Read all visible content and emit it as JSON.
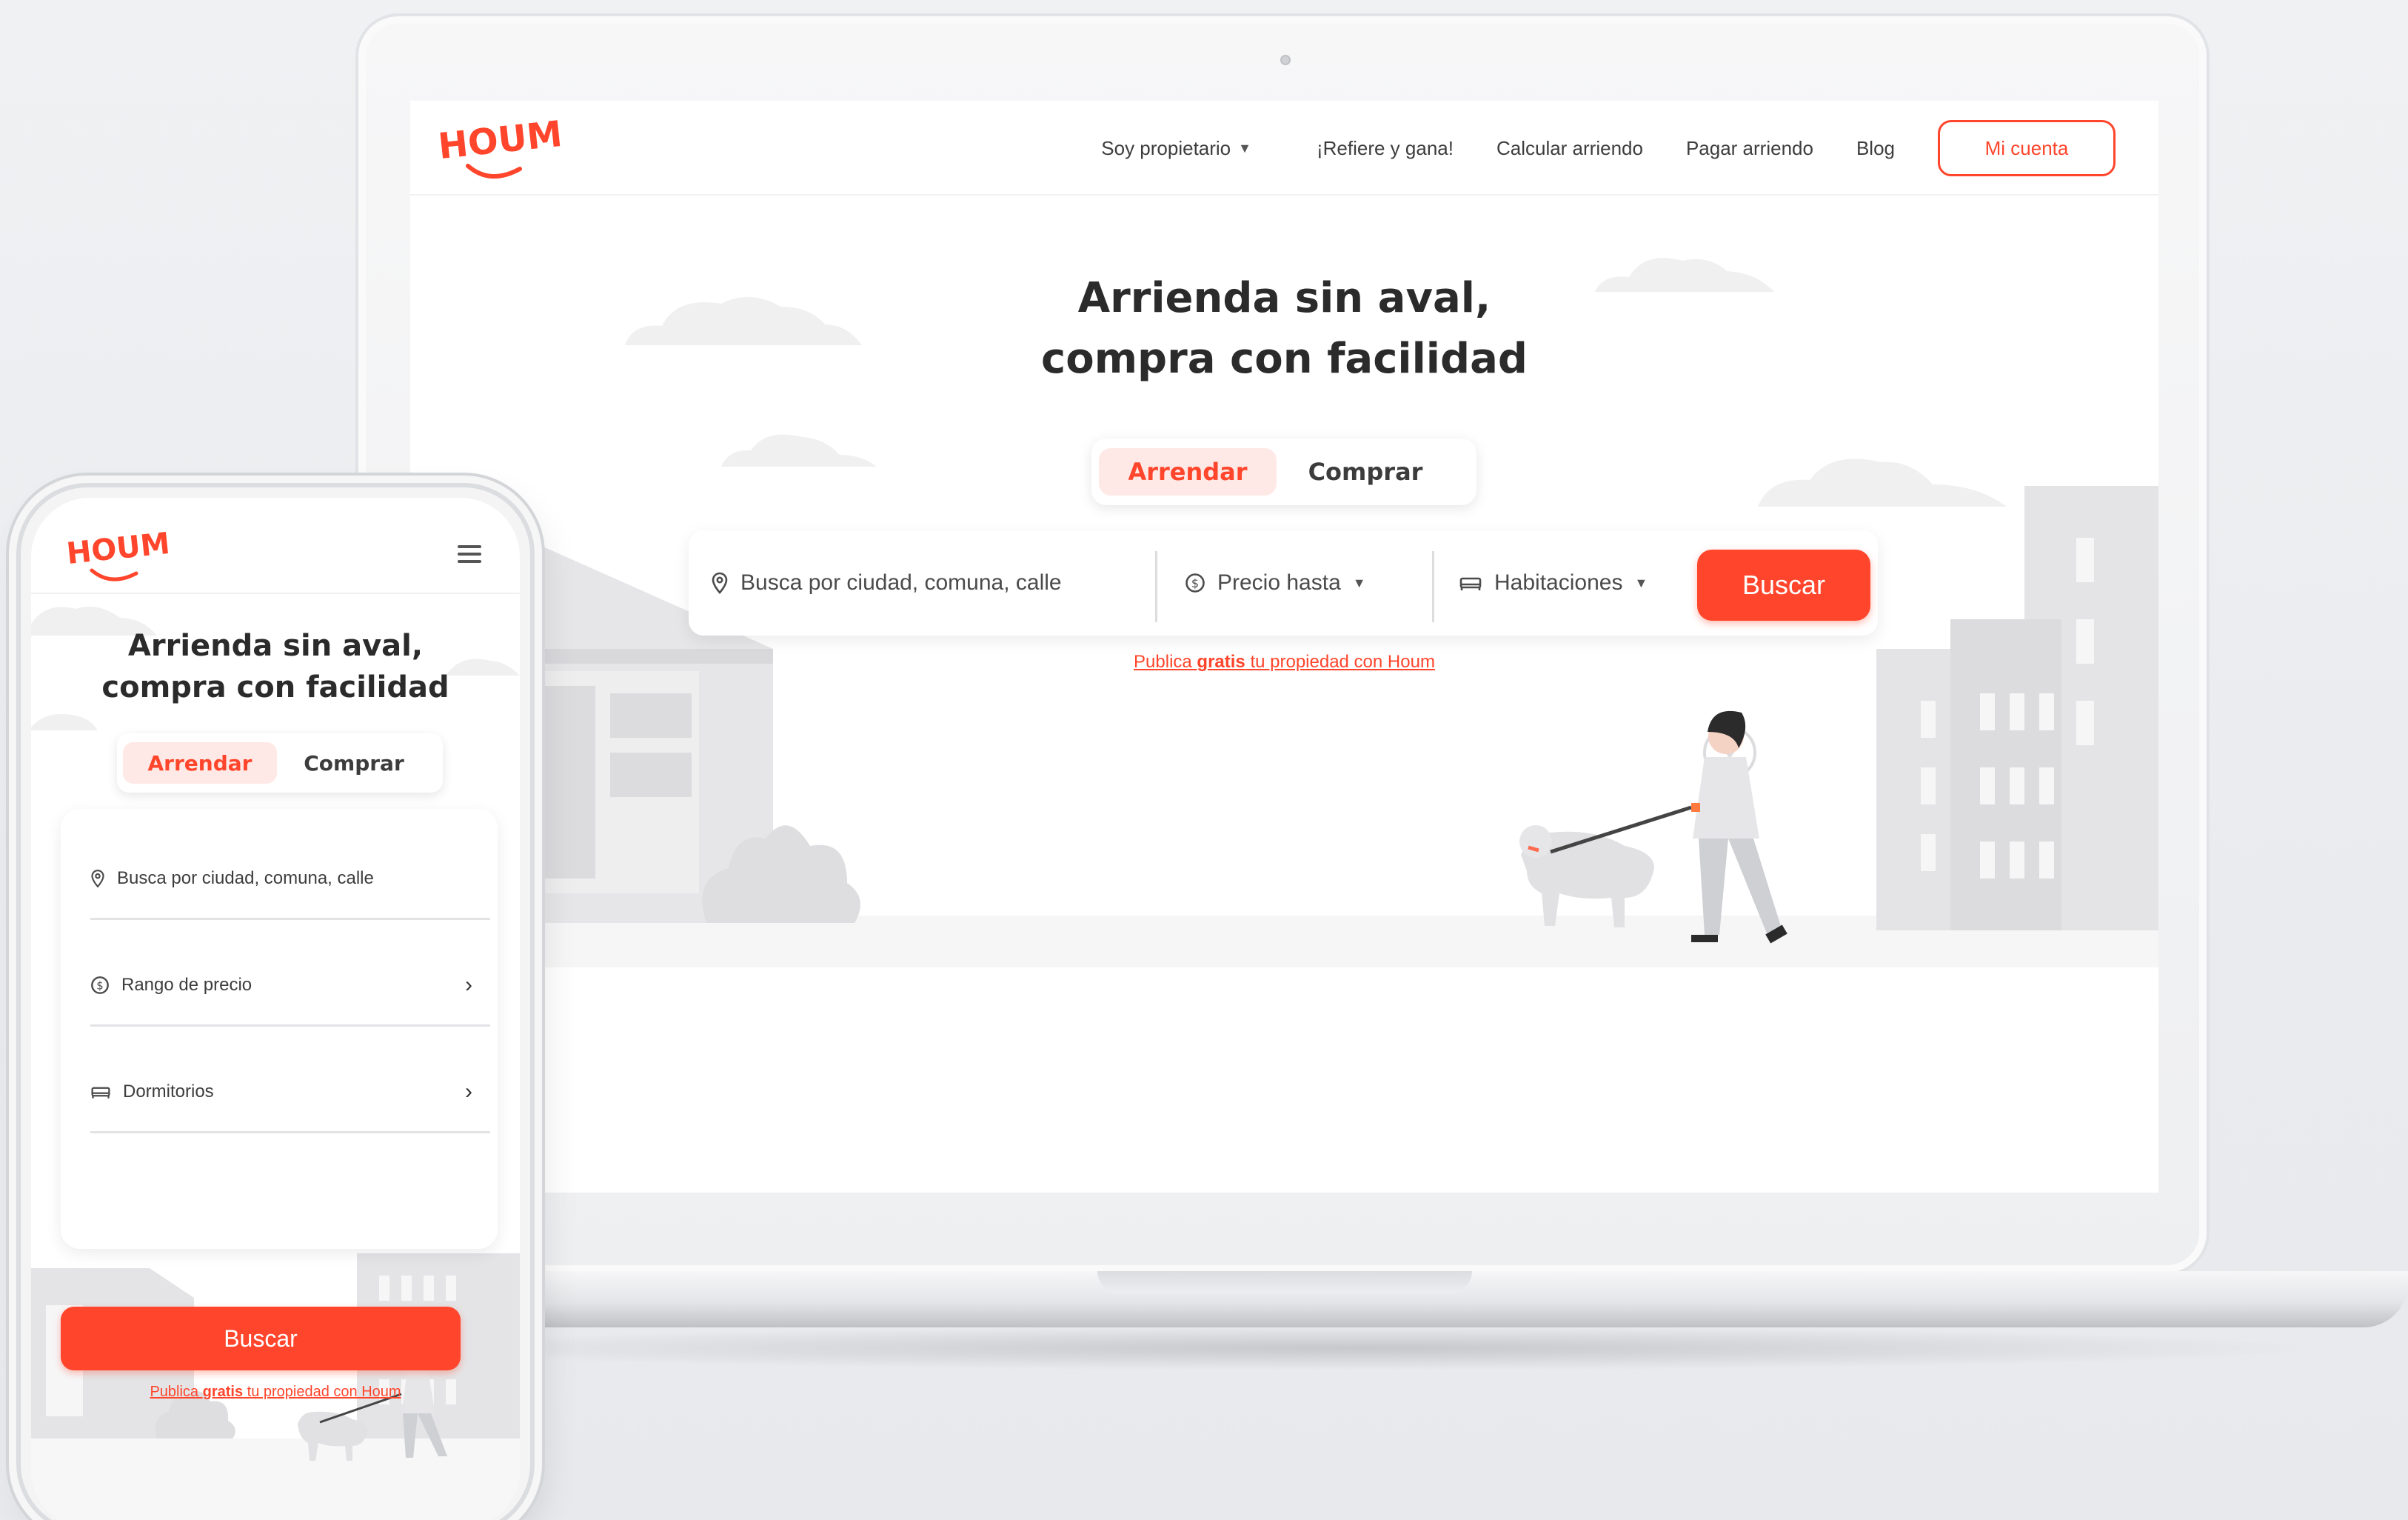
{
  "colors": {
    "brand": "#ff452b",
    "brand_light": "#ffe9e6",
    "text": "#2b2b2b"
  },
  "brand": {
    "name": "HOUM"
  },
  "desktop": {
    "nav": {
      "owner": "Soy propietario",
      "refer": "¡Refiere y gana!",
      "calc": "Calcular arriendo",
      "pay": "Pagar arriendo",
      "blog": "Blog",
      "account": "Mi cuenta"
    },
    "hero": {
      "line1": "Arrienda sin aval,",
      "line2": "compra con facilidad"
    },
    "tabs": {
      "rent": "Arrendar",
      "buy": "Comprar",
      "active": "rent"
    },
    "search": {
      "location_placeholder": "Busca por ciudad, comuna, calle",
      "price": "Precio hasta",
      "rooms": "Habitaciones",
      "button": "Buscar"
    },
    "publish": {
      "pre": "Publica ",
      "bold": "gratis",
      "post": " tu propiedad con Houm"
    }
  },
  "mobile": {
    "hero": {
      "line1": "Arrienda sin aval,",
      "line2": "compra con facilidad"
    },
    "tabs": {
      "rent": "Arrendar",
      "buy": "Comprar",
      "active": "rent"
    },
    "fields": {
      "location": "Busca por ciudad, comuna, calle",
      "price": "Rango de precio",
      "bedrooms": "Dormitorios"
    },
    "button": "Buscar",
    "publish": {
      "pre": "Publica ",
      "bold": "gratis",
      "post": " tu propiedad con Houm"
    }
  }
}
